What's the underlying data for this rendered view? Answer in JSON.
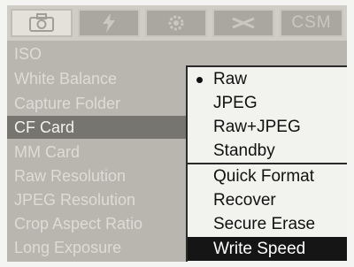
{
  "tabs": [
    {
      "icon": "camera-icon",
      "active": true
    },
    {
      "icon": "bolt-icon",
      "active": false
    },
    {
      "icon": "gear-icon",
      "active": false
    },
    {
      "icon": "wrench-icon",
      "active": false
    },
    {
      "label": "CSM",
      "active": false
    }
  ],
  "menu": {
    "items": [
      {
        "label": "ISO"
      },
      {
        "label": "White Balance"
      },
      {
        "label": "Capture Folder"
      },
      {
        "label": "CF Card",
        "selected": true
      },
      {
        "label": "MM Card"
      },
      {
        "label": "Raw Resolution"
      },
      {
        "label": "JPEG Resolution"
      },
      {
        "label": "Crop Aspect Ratio"
      },
      {
        "label": "Long Exposure"
      }
    ]
  },
  "popup": {
    "options": [
      {
        "label": "Raw",
        "checked": true
      },
      {
        "label": "JPEG"
      },
      {
        "label": "Raw+JPEG"
      },
      {
        "label": "Standby"
      }
    ],
    "actions": [
      {
        "label": "Quick Format"
      },
      {
        "label": "Recover"
      },
      {
        "label": "Secure Erase"
      },
      {
        "label": "Write Speed",
        "highlighted": true
      }
    ]
  }
}
